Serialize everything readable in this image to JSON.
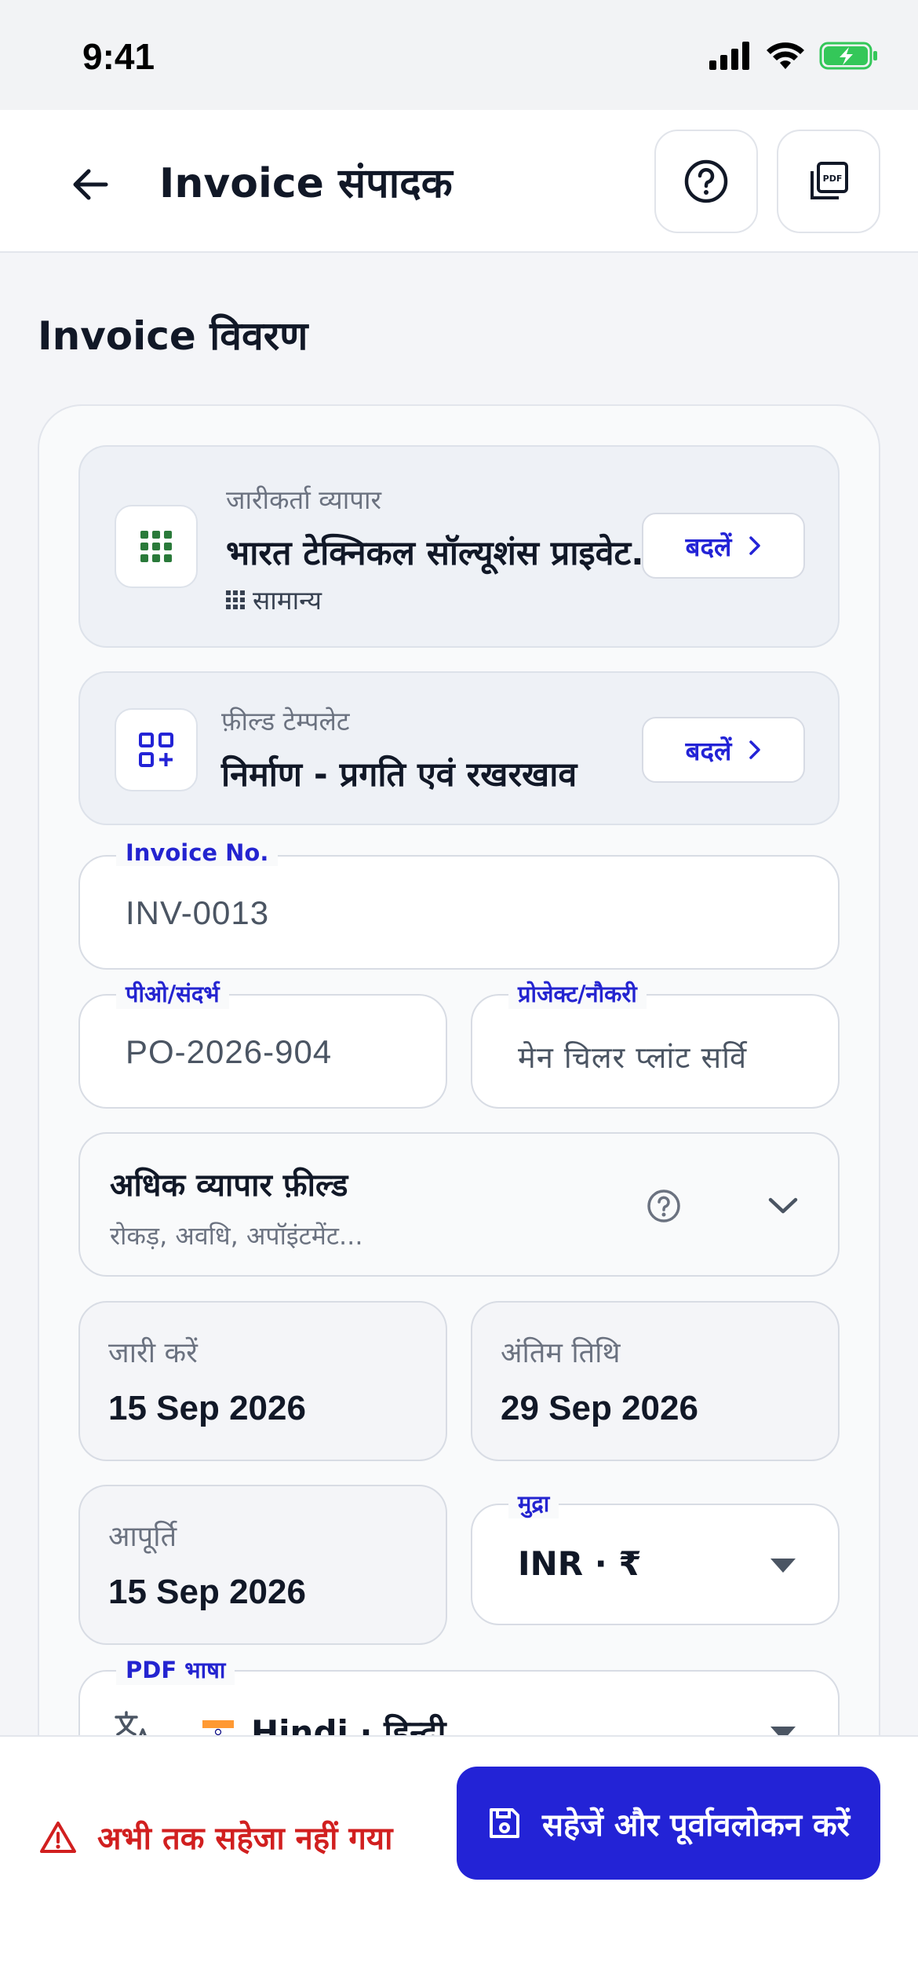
{
  "status_bar": {
    "time": "9:41"
  },
  "header": {
    "title": "Invoice संपादक",
    "back_icon": "arrow-left-icon",
    "help_icon": "help-circle-icon",
    "pdf_icon": "pdf-file-icon"
  },
  "section_title": "Invoice विवरण",
  "issuer": {
    "label": "जारीकर्ता व्यापार",
    "name": "भारत टेक्निकल सॉल्यूशंस प्राइवेट...",
    "category": "सामान्य",
    "change_label": "बदलें"
  },
  "template": {
    "label": "फ़ील्ड टेम्पलेट",
    "name": "निर्माण - प्रगति एवं रखरखाव",
    "change_label": "बदलें"
  },
  "invoice_no": {
    "label": "Invoice No.",
    "value": "INV-0013"
  },
  "po_ref": {
    "label": "पीओ/संदर्भ",
    "value": "PO-2026-904"
  },
  "project": {
    "label": "प्रोजेक्ट/नौकरी",
    "value": "मेन चिलर प्लांट सर्वि"
  },
  "extra_fields": {
    "title": "अधिक व्यापार फ़ील्ड",
    "subtitle": "रोकड़, अवधि, अपॉइंटमेंट..."
  },
  "issue_date": {
    "label": "जारी करें",
    "value": "15 Sep 2026"
  },
  "due_date": {
    "label": "अंतिम तिथि",
    "value": "29 Sep 2026"
  },
  "supply_date": {
    "label": "आपूर्ति",
    "value": "15 Sep 2026"
  },
  "currency": {
    "label": "मुद्रा",
    "value": "INR · ₹"
  },
  "pdf_language": {
    "label": "PDF भाषा",
    "value": "Hindi · हिन्दी"
  },
  "footer": {
    "unsaved_text": "अभी तक सहेजा नहीं गया",
    "save_label": "सहेजें और पूर्वावलोकन करें"
  },
  "colors": {
    "accent": "#2323D6",
    "warning": "#D11F1F",
    "battery": "#34C759"
  }
}
